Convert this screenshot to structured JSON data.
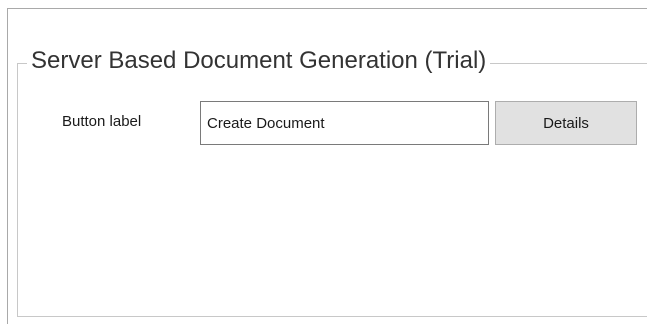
{
  "group": {
    "title": "Server Based Document Generation (Trial)"
  },
  "form": {
    "button_label_caption": "Button label",
    "button_label_value": "Create Document",
    "details_label": "Details"
  },
  "colors": {
    "background": "#ffffff",
    "button_face": "#e1e1e1",
    "button_border": "#adadad",
    "input_border": "#7a7a7a",
    "group_border": "#c8c8c8"
  }
}
